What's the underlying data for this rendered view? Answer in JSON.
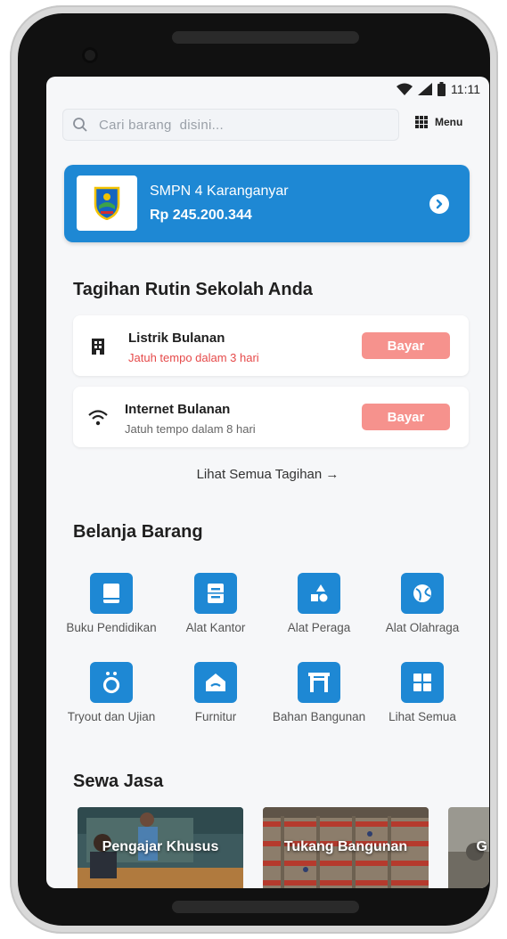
{
  "status_bar": {
    "time": "11:11"
  },
  "search": {
    "placeholder": "Cari barang  disini..."
  },
  "menu": {
    "label": "Menu"
  },
  "school": {
    "name": "SMPN 4 Karanganyar",
    "balance": "Rp 245.200.344"
  },
  "bills_section": {
    "title": "Tagihan Rutin Sekolah Anda"
  },
  "bills": [
    {
      "title": "Listrik Bulanan",
      "subtitle": "Jatuh tempo dalam 3 hari",
      "button": "Bayar",
      "icon": "building-icon",
      "subtitle_color": "#e64a4a"
    },
    {
      "title": "Internet Bulanan",
      "subtitle": "Jatuh tempo dalam 8 hari",
      "button": "Bayar",
      "icon": "wifi-icon",
      "subtitle_color": "#666666"
    }
  ],
  "see_all_bills": "Lihat Semua Tagihan →",
  "shop_section": {
    "title": "Belanja Barang"
  },
  "categories": [
    {
      "label": "Buku Pendidikan",
      "icon": "book-icon"
    },
    {
      "label": "Alat Kantor",
      "icon": "cabinet-icon"
    },
    {
      "label": "Alat Peraga",
      "icon": "shapes-icon"
    },
    {
      "label": "Alat Olahraga",
      "icon": "ball-icon"
    },
    {
      "label": "Tryout dan Ujian",
      "icon": "exam-icon"
    },
    {
      "label": "Furnitur",
      "icon": "home-icon"
    },
    {
      "label": "Bahan Bangunan",
      "icon": "gate-icon"
    },
    {
      "label": "Lihat Semua",
      "icon": "grid-icon"
    }
  ],
  "services_section": {
    "title": "Sewa Jasa"
  },
  "services": [
    {
      "label": "Pengajar Khusus"
    },
    {
      "label": "Tukang Bangunan"
    },
    {
      "label": "G"
    }
  ],
  "colors": {
    "primary": "#1e88d4",
    "pay_button": "#f6928d",
    "overdue": "#e64a4a"
  }
}
